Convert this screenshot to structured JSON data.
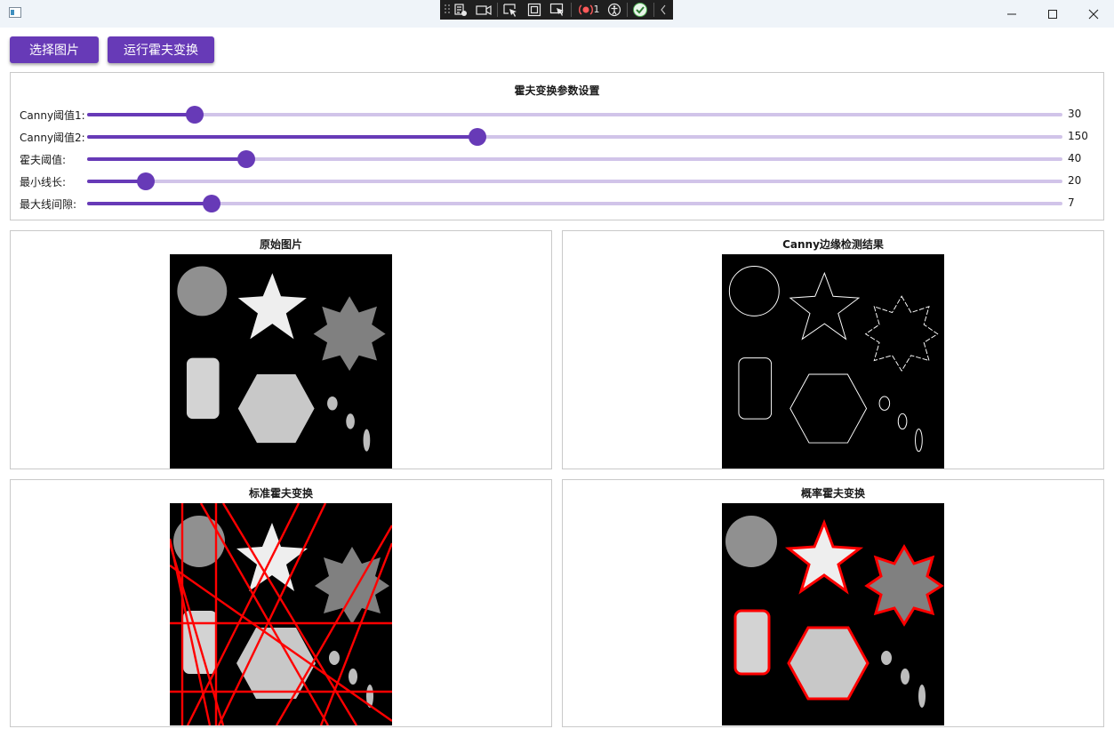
{
  "toolbar": {
    "select_image_label": "选择图片",
    "run_hough_label": "运行霍夫变换"
  },
  "debug_toolbar": {
    "error_count": "1"
  },
  "params_panel": {
    "title": "霍夫变换参数设置",
    "sliders": [
      {
        "label": "Canny阈值1:",
        "value": "30",
        "fraction": 0.11
      },
      {
        "label": "Canny阈值2:",
        "value": "150",
        "fraction": 0.4
      },
      {
        "label": "霍夫阈值:",
        "value": "40",
        "fraction": 0.163
      },
      {
        "label": "最小线长:",
        "value": "20",
        "fraction": 0.06
      },
      {
        "label": "最大线间隙:",
        "value": "7",
        "fraction": 0.128
      }
    ]
  },
  "images": {
    "original_title": "原始图片",
    "canny_title": "Canny边缘检测结果",
    "standard_hough_title": "标准霍夫变换",
    "probabilistic_hough_title": "概率霍夫变换"
  },
  "colors": {
    "accent": "#673ab7",
    "track": "#d1c4e9",
    "detected_line": "#ff0000"
  },
  "icons": [
    "window-app-icon",
    "minimize-icon",
    "maximize-icon",
    "close-icon"
  ]
}
